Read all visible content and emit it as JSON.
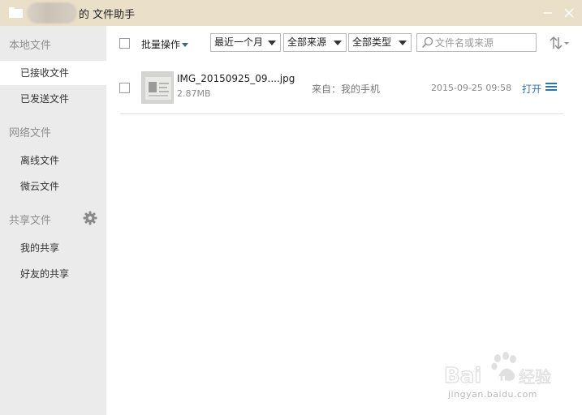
{
  "window": {
    "title": "的 文件助手"
  },
  "sidebar": {
    "sections": [
      {
        "label": "本地文件",
        "items": [
          "已接收文件",
          "已发送文件"
        ]
      },
      {
        "label": "网络文件",
        "items": [
          "离线文件",
          "微云文件"
        ]
      },
      {
        "label": "共享文件",
        "items": [
          "我的共享",
          "好友的共享"
        ]
      }
    ],
    "active_item": "已接收文件"
  },
  "toolbar": {
    "batch_label": "批量操作",
    "filters": [
      {
        "selected": "最近一个月"
      },
      {
        "selected": "全部来源"
      },
      {
        "selected": "全部类型"
      }
    ],
    "search": {
      "placeholder": "文件名或来源",
      "value": ""
    }
  },
  "files": [
    {
      "name": "IMG_20150925_09....jpg",
      "size": "2.87MB",
      "source": "来自：我的手机",
      "date": "2015-09-25 09:58",
      "action": "打开"
    }
  ],
  "watermark": {
    "brand": "Bai du 经验",
    "url": "jingyan.baidu.com"
  },
  "colors": {
    "titlebar": "#eadfc8",
    "sidebar": "#ebebeb",
    "accent": "#2a74b8"
  }
}
